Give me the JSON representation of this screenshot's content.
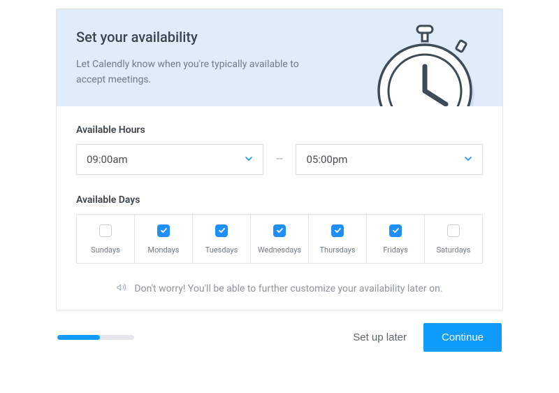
{
  "header": {
    "title": "Set your availability",
    "subtitle": "Let Calendly know when you're typically available to accept meetings."
  },
  "hours": {
    "label": "Available Hours",
    "from": "09:00am",
    "to": "05:00pm",
    "separator": "—"
  },
  "days": {
    "label": "Available Days",
    "items": [
      {
        "label": "Sundays",
        "checked": false
      },
      {
        "label": "Mondays",
        "checked": true
      },
      {
        "label": "Tuesdays",
        "checked": true
      },
      {
        "label": "Wednesdays",
        "checked": true
      },
      {
        "label": "Thursdays",
        "checked": true
      },
      {
        "label": "Fridays",
        "checked": true
      },
      {
        "label": "Saturdays",
        "checked": false
      }
    ]
  },
  "hint": "Don't worry! You'll be able to further customize your availability later on.",
  "footer": {
    "progress_percent": 55,
    "later": "Set up later",
    "continue": "Continue"
  }
}
